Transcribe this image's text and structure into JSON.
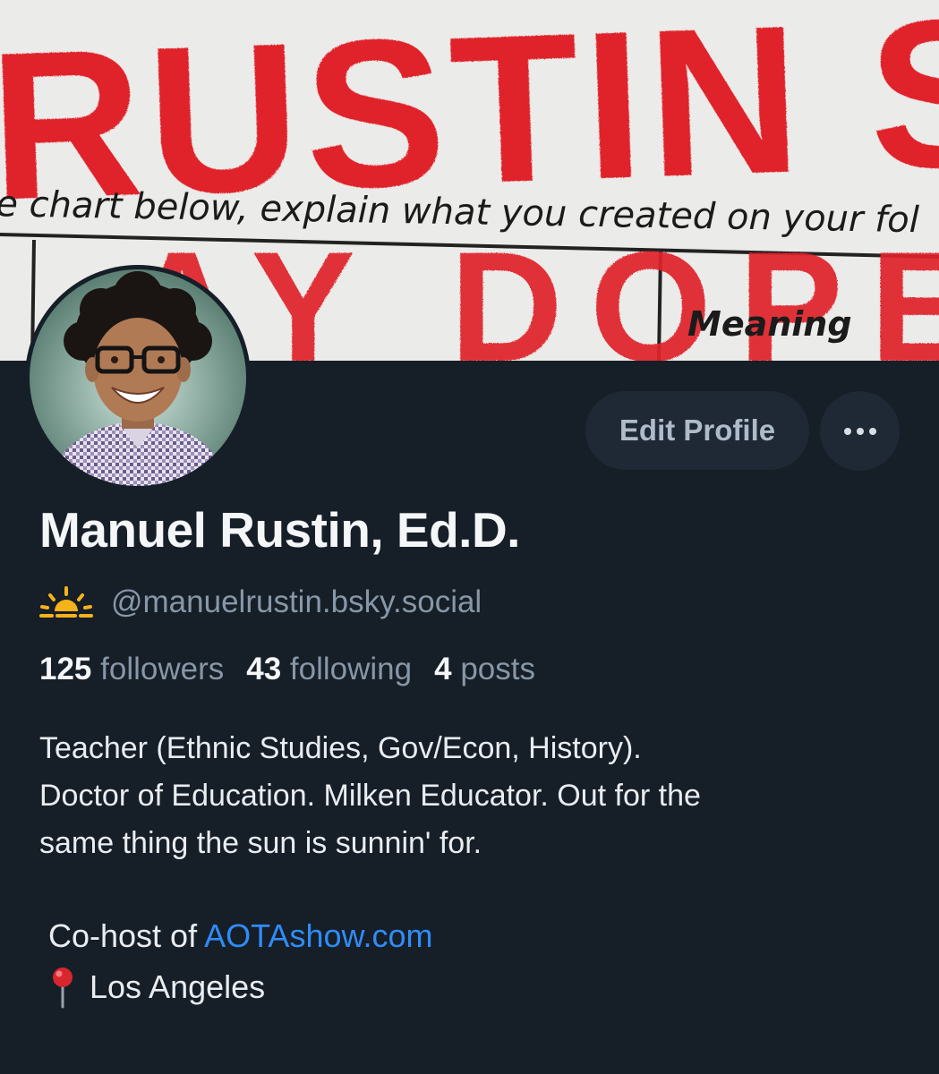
{
  "banner": {
    "headline": "RUSTIN SAYS",
    "subline": "e chart below, explain what you created on your fol",
    "stamp": "AY DOPE",
    "column_label": "Meaning"
  },
  "profile": {
    "display_name": "Manuel Rustin, Ed.D.",
    "handle": "@manuelrustin.bsky.social",
    "handle_emoji_icon": "sunrise-icon"
  },
  "actions": {
    "edit_label": "Edit Profile",
    "more_icon": "ellipsis-icon"
  },
  "stats": {
    "followers_count": "125",
    "followers_label": "followers",
    "following_count": "43",
    "following_label": "following",
    "posts_count": "4",
    "posts_label": "posts"
  },
  "bio": {
    "lines": [
      "Teacher (Ethnic Studies, Gov/Econ, History).",
      "Doctor of Education. Milken Educator. Out for the",
      "same thing the sun is sunnin' for."
    ],
    "cohost_prefix": "Co-host of ",
    "cohost_link": "AOTAshow.com",
    "location": "Los Angeles",
    "location_icon": "pin-icon"
  },
  "colors": {
    "background": "#161e27",
    "button_bg": "#1e2935",
    "link": "#2f8cf7",
    "muted": "#8797a8",
    "banner_red": "#e0202a"
  }
}
